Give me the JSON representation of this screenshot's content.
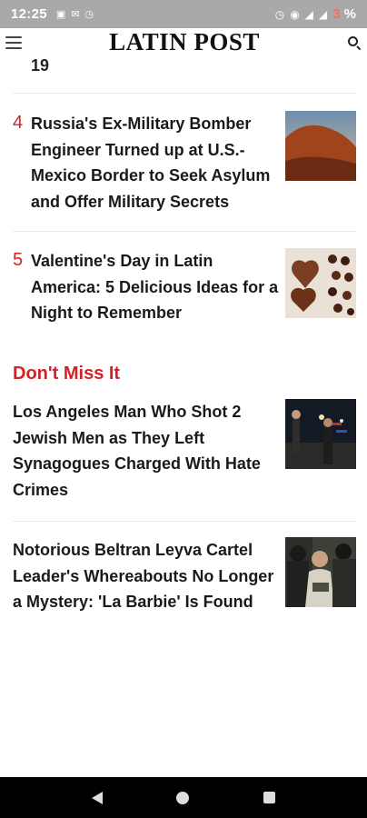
{
  "status_bar": {
    "time": "12:25",
    "battery": "3",
    "battery_suffix": " %"
  },
  "header": {
    "brand": "LATIN POST"
  },
  "previous_item_tail": "19",
  "articles": [
    {
      "rank": "4",
      "title": "Russia's Ex-Military Bomber Engineer Turned up at U.S.-Mexico Border to Seek Asylum and Offer Military Secrets"
    },
    {
      "rank": "5",
      "title": "Valentine's Day in Latin America: 5 Delicious Ideas for a Night to Remember"
    }
  ],
  "dont_miss": {
    "heading": "Don't Miss It",
    "items": [
      {
        "title": "Los Angeles Man Who Shot 2 Jewish Men as They Left Synagogues Charged With Hate Crimes"
      },
      {
        "title": "Notorious Beltran Leyva Cartel Leader's Whereabouts No Longer a Mystery: 'La Barbie' Is Found"
      }
    ]
  },
  "colors": {
    "accent": "#d62028",
    "status_bar": "#a9a9a9"
  }
}
